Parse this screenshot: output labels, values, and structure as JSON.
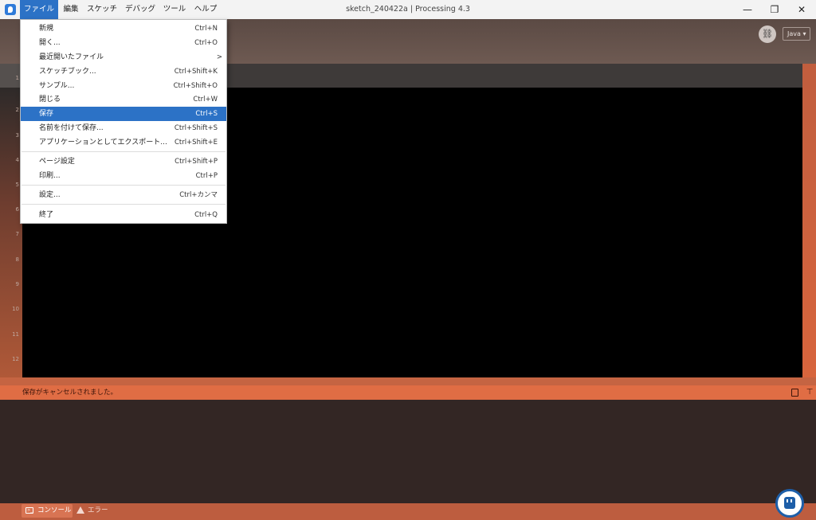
{
  "window": {
    "title": "sketch_240422a | Processing 4.3",
    "minimize": "—",
    "maximize": "❐",
    "close": "✕"
  },
  "menubar": {
    "file": "ファイル",
    "edit": "編集",
    "sketch": "スケッチ",
    "debug": "デバッグ",
    "tools": "ツール",
    "help": "ヘルプ"
  },
  "file_menu": {
    "items": [
      {
        "label": "新規",
        "shortcut": "Ctrl+N"
      },
      {
        "label": "開く...",
        "shortcut": "Ctrl+O"
      },
      {
        "label": "最近開いたファイル",
        "shortcut": ">"
      },
      {
        "label": "スケッチブック...",
        "shortcut": "Ctrl+Shift+K"
      },
      {
        "label": "サンプル...",
        "shortcut": "Ctrl+Shift+O"
      },
      {
        "label": "閉じる",
        "shortcut": "Ctrl+W"
      },
      {
        "label": "保存",
        "shortcut": "Ctrl+S"
      },
      {
        "label": "名前を付けて保存...",
        "shortcut": "Ctrl+Shift+S"
      },
      {
        "label": "アプリケーションとしてエクスポート...",
        "shortcut": "Ctrl+Shift+E"
      },
      {
        "label": "ページ設定",
        "shortcut": "Ctrl+Shift+P"
      },
      {
        "label": "印刷...",
        "shortcut": "Ctrl+P"
      },
      {
        "label": "設定...",
        "shortcut": "Ctrl+カンマ"
      },
      {
        "label": "終了",
        "shortcut": "Ctrl+Q"
      }
    ],
    "highlighted": "保存"
  },
  "toolbar": {
    "debug_glyph": "⛓",
    "mode": "Java ▾"
  },
  "editor": {
    "line_numbers": [
      "1",
      "2",
      "3",
      "4",
      "5",
      "6",
      "7",
      "8",
      "9",
      "10",
      "11",
      "12"
    ]
  },
  "status": {
    "message": "保存がキャンセルされました。",
    "down_arrow": "⊤"
  },
  "console_tabs": {
    "console": "コンソール",
    "errors": "エラー",
    "console_icon": ">_"
  },
  "colors": {
    "accent": "#2c72c6",
    "status_bar": "#e06d44",
    "editor_bg": "#000000",
    "console_bg": "#332624"
  }
}
